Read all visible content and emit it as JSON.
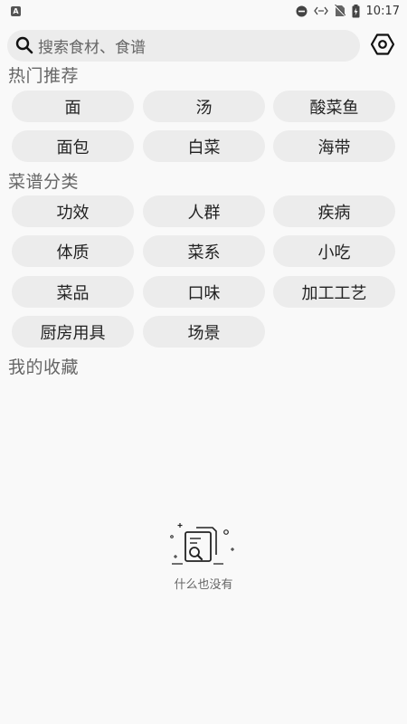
{
  "status_bar": {
    "time": "10:17",
    "icons": [
      "app-notification-icon",
      "do-not-disturb-icon",
      "data-transfer-icon",
      "no-sim-icon",
      "battery-charging-icon"
    ]
  },
  "search": {
    "placeholder": "搜索食材、食谱"
  },
  "sections": {
    "hot": {
      "title": "热门推荐",
      "items": [
        "面",
        "汤",
        "酸菜鱼",
        "面包",
        "白菜",
        "海带"
      ]
    },
    "categories": {
      "title": "菜谱分类",
      "items": [
        "功效",
        "人群",
        "疾病",
        "体质",
        "菜系",
        "小吃",
        "菜品",
        "口味",
        "加工工艺",
        "厨房用具",
        "场景"
      ]
    },
    "favorites": {
      "title": "我的收藏",
      "empty_text": "什么也没有"
    }
  },
  "colors": {
    "background": "#f9f9f9",
    "chip": "#ececec",
    "section_title": "#666666"
  }
}
